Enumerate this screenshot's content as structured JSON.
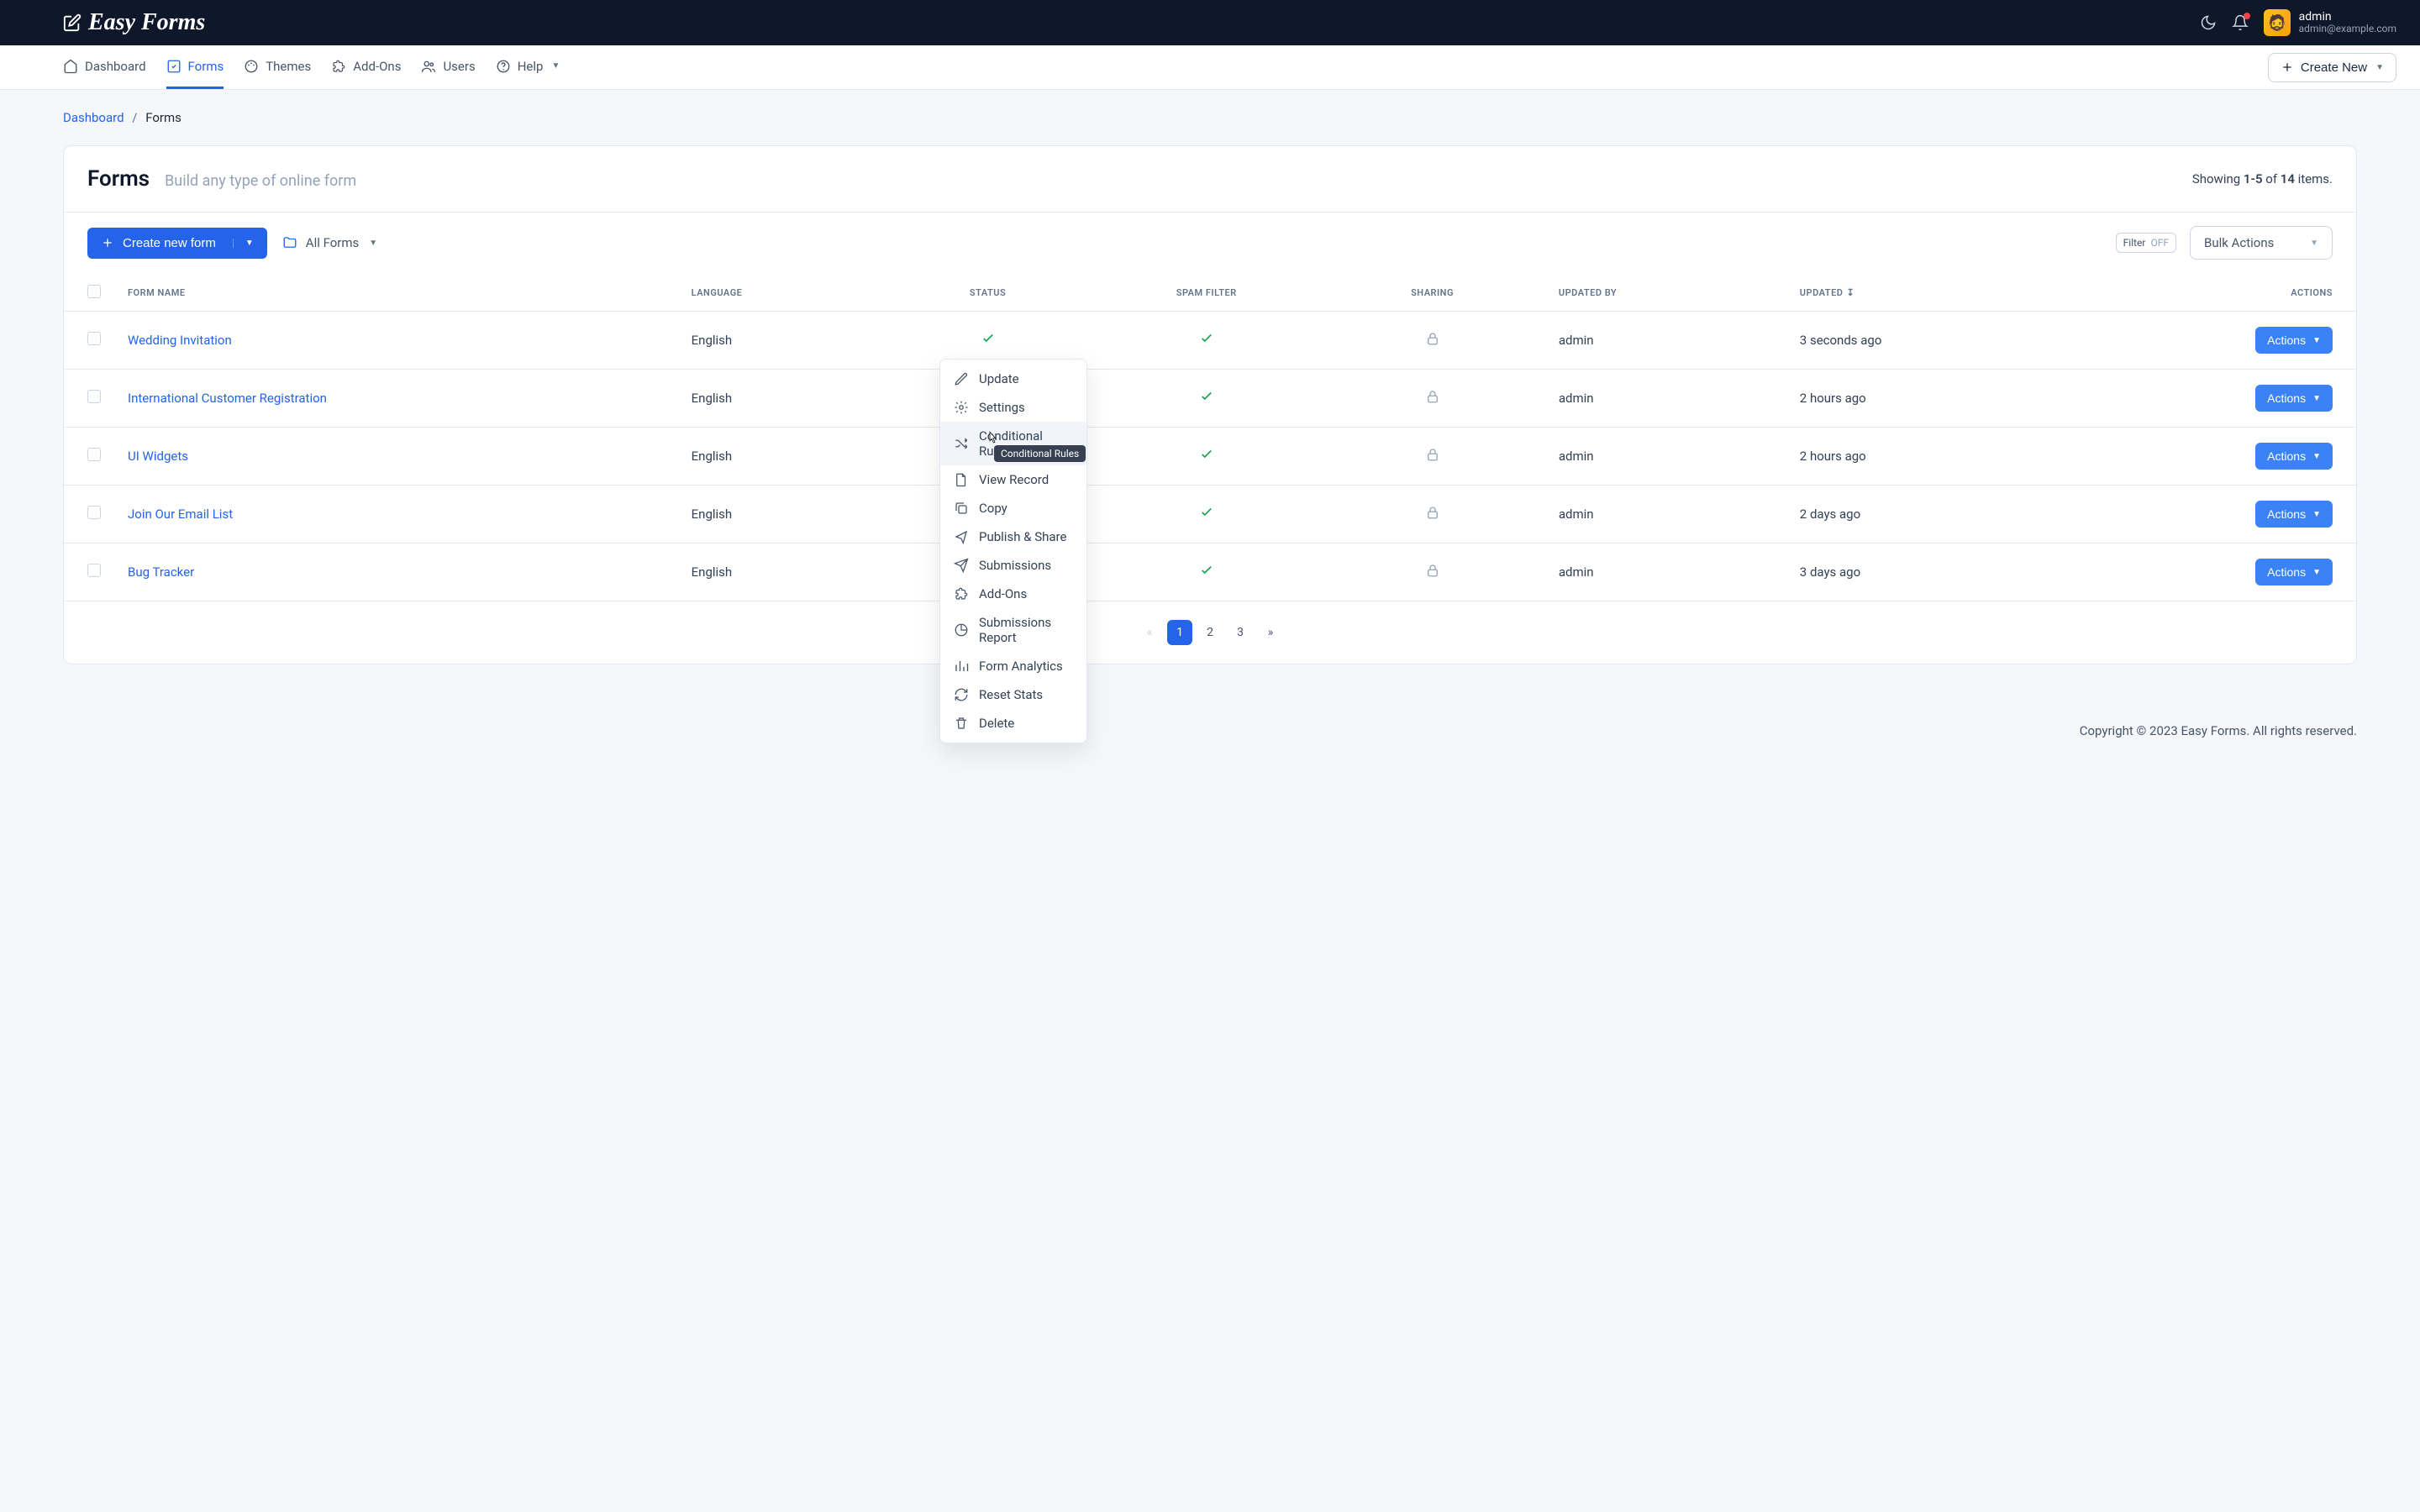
{
  "brand": "Easy Forms",
  "user": {
    "name": "admin",
    "email": "admin@example.com"
  },
  "nav": {
    "items": [
      {
        "label": "Dashboard"
      },
      {
        "label": "Forms"
      },
      {
        "label": "Themes"
      },
      {
        "label": "Add-Ons"
      },
      {
        "label": "Users"
      },
      {
        "label": "Help"
      }
    ],
    "create_label": "Create New"
  },
  "breadcrumb": {
    "root": "Dashboard",
    "leaf": "Forms"
  },
  "page": {
    "title": "Forms",
    "subtitle": "Build any type of online form",
    "showing_prefix": "Showing ",
    "showing_range": "1-5",
    "showing_of": " of ",
    "showing_total": "14",
    "showing_suffix": " items."
  },
  "toolbar": {
    "create_form": "Create new form",
    "folder_label": "All Forms",
    "filter_label": "Filter",
    "filter_state": "OFF",
    "bulk_label": "Bulk Actions"
  },
  "columns": {
    "name": "FORM NAME",
    "language": "LANGUAGE",
    "status": "STATUS",
    "spam": "SPAM FILTER",
    "sharing": "SHARING",
    "updated_by": "UPDATED BY",
    "updated": "UPDATED",
    "actions": "ACTIONS"
  },
  "rows": [
    {
      "name": "Wedding Invitation",
      "language": "English",
      "updated_by": "admin",
      "updated": "3 seconds ago"
    },
    {
      "name": "International Customer Registration",
      "language": "English",
      "updated_by": "admin",
      "updated": "2 hours ago"
    },
    {
      "name": "UI Widgets",
      "language": "English",
      "updated_by": "admin",
      "updated": "2 hours ago"
    },
    {
      "name": "Join Our Email List",
      "language": "English",
      "updated_by": "admin",
      "updated": "2 days ago"
    },
    {
      "name": "Bug Tracker",
      "language": "English",
      "updated_by": "admin",
      "updated": "3 days ago"
    }
  ],
  "actions_label": "Actions",
  "pagination": {
    "prev": "«",
    "pages": [
      "1",
      "2",
      "3"
    ],
    "next": "»"
  },
  "footer": "Copyright © 2023 Easy Forms. All rights reserved.",
  "dropdown": {
    "items": [
      {
        "label": "Update"
      },
      {
        "label": "Settings"
      },
      {
        "label": "Conditional Rules"
      },
      {
        "label": "View Record"
      },
      {
        "label": "Copy"
      },
      {
        "label": "Publish & Share"
      },
      {
        "label": "Submissions"
      },
      {
        "label": "Add-Ons"
      },
      {
        "label": "Submissions Report"
      },
      {
        "label": "Form Analytics"
      },
      {
        "label": "Reset Stats"
      },
      {
        "label": "Delete"
      }
    ]
  },
  "tooltip_text": "Conditional Rules"
}
